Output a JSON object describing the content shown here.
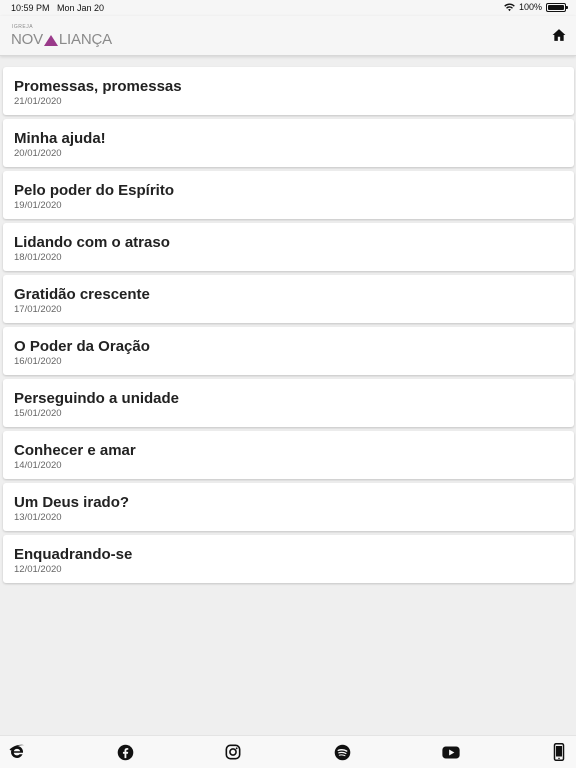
{
  "status_bar": {
    "time": "10:59 PM",
    "date": "Mon Jan 20",
    "battery": "100%"
  },
  "header": {
    "logo_small": "IGREJA",
    "logo_part1": "NOV",
    "logo_part2": "LIANÇA"
  },
  "posts": [
    {
      "title": "Promessas, promessas",
      "date": "21/01/2020"
    },
    {
      "title": "Minha ajuda!",
      "date": "20/01/2020"
    },
    {
      "title": "Pelo poder do Espírito",
      "date": "19/01/2020"
    },
    {
      "title": "Lidando com o atraso",
      "date": "18/01/2020"
    },
    {
      "title": "Gratidão crescente",
      "date": "17/01/2020"
    },
    {
      "title": "O Poder da Oração",
      "date": "16/01/2020"
    },
    {
      "title": "Perseguindo a unidade",
      "date": "15/01/2020"
    },
    {
      "title": "Conhecer e amar",
      "date": "14/01/2020"
    },
    {
      "title": "Um Deus irado?",
      "date": "13/01/2020"
    },
    {
      "title": "Enquadrando-se",
      "date": "12/01/2020"
    }
  ],
  "tab_bar": {
    "icons": [
      "e-logo-icon",
      "facebook-icon",
      "instagram-icon",
      "spotify-icon",
      "youtube-icon",
      "phone-icon"
    ]
  },
  "colors": {
    "logo_accent": "#9a3a8a",
    "background": "#efefef"
  }
}
